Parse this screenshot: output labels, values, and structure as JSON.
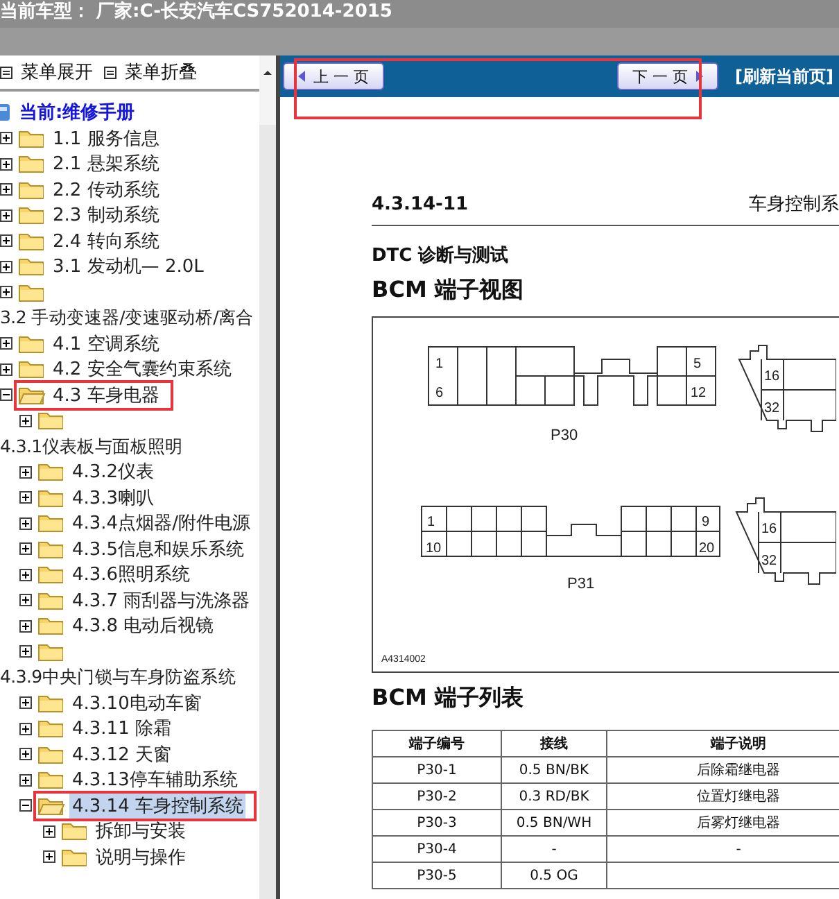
{
  "title_bar": {
    "text": "当前车型：  厂家:C-长安汽车CS752014-2015"
  },
  "tree_toolbar": [
    {
      "label": "菜单展开"
    },
    {
      "label": "菜单折叠"
    }
  ],
  "tree": {
    "root": "当前:维修手册",
    "items": [
      {
        "kind": "folder",
        "label": "1.1 服务信息",
        "expanded": false,
        "selected": false,
        "highlighted": false
      },
      {
        "kind": "folder",
        "label": "2.1 悬架系统",
        "expanded": false,
        "selected": false,
        "highlighted": false
      },
      {
        "kind": "folder",
        "label": "2.2 传动系统",
        "expanded": false,
        "selected": false,
        "highlighted": false
      },
      {
        "kind": "folder",
        "label": "2.3 制动系统",
        "expanded": false,
        "selected": false,
        "highlighted": false
      },
      {
        "kind": "folder",
        "label": "2.4 转向系统",
        "expanded": false,
        "selected": false,
        "highlighted": false
      },
      {
        "kind": "folder",
        "label": "3.1 发动机— 2.0L",
        "expanded": false,
        "selected": false,
        "highlighted": false
      },
      {
        "kind": "wrapped",
        "label": "3.2 手动变速器/变速驱动桥/离合",
        "expanded": false,
        "selected": false,
        "highlighted": false
      },
      {
        "kind": "folder",
        "label": "4.1 空调系统",
        "expanded": false,
        "selected": false,
        "highlighted": false
      },
      {
        "kind": "folder",
        "label": "4.2 安全气囊约束系统",
        "expanded": false,
        "selected": false,
        "highlighted": false
      },
      {
        "kind": "folder",
        "label": "4.3 车身电器",
        "expanded": true,
        "selected": false,
        "highlighted": true,
        "children": [
          {
            "kind": "wrapped",
            "label": "4.3.1仪表板与面板照明",
            "expanded": false,
            "selected": false,
            "highlighted": false
          },
          {
            "kind": "folder",
            "label": "4.3.2仪表",
            "expanded": false,
            "selected": false,
            "highlighted": false
          },
          {
            "kind": "folder",
            "label": "4.3.3喇叭",
            "expanded": false,
            "selected": false,
            "highlighted": false
          },
          {
            "kind": "folder",
            "label": "4.3.4点烟器/附件电源",
            "expanded": false,
            "selected": false,
            "highlighted": false
          },
          {
            "kind": "folder",
            "label": "4.3.5信息和娱乐系统",
            "expanded": false,
            "selected": false,
            "highlighted": false
          },
          {
            "kind": "folder",
            "label": "4.3.6照明系统",
            "expanded": false,
            "selected": false,
            "highlighted": false
          },
          {
            "kind": "folder",
            "label": "4.3.7 雨刮器与洗涤器",
            "expanded": false,
            "selected": false,
            "highlighted": false
          },
          {
            "kind": "folder",
            "label": "4.3.8 电动后视镜",
            "expanded": false,
            "selected": false,
            "highlighted": false
          },
          {
            "kind": "wrapped",
            "label": "4.3.9中央门锁与车身防盗系统",
            "expanded": false,
            "selected": false,
            "highlighted": false
          },
          {
            "kind": "folder",
            "label": "4.3.10电动车窗",
            "expanded": false,
            "selected": false,
            "highlighted": false
          },
          {
            "kind": "folder",
            "label": "4.3.11 除霜",
            "expanded": false,
            "selected": false,
            "highlighted": false
          },
          {
            "kind": "folder",
            "label": "4.3.12 天窗",
            "expanded": false,
            "selected": false,
            "highlighted": false
          },
          {
            "kind": "folder",
            "label": "4.3.13停车辅助系统",
            "expanded": false,
            "selected": false,
            "highlighted": false
          },
          {
            "kind": "folder",
            "label": "4.3.14 车身控制系统",
            "expanded": true,
            "selected": true,
            "highlighted": true,
            "children": [
              {
                "kind": "folder",
                "label": "拆卸与安装",
                "expanded": false,
                "selected": false,
                "highlighted": false
              },
              {
                "kind": "folder",
                "label": "说明与操作",
                "expanded": false,
                "selected": false,
                "highlighted": false
              }
            ]
          }
        ]
      }
    ]
  },
  "nav_bar": {
    "prev": "上 一 页",
    "next": "下 一 页",
    "refresh": "[刷新当前页]",
    "highlighted": true
  },
  "document": {
    "page_number": "4.3.14-11",
    "chapter": "车身控制系",
    "section": "DTC 诊断与测试",
    "heading_view": "BCM 端子视图",
    "connectors": [
      {
        "kind": "p30",
        "name": "P30",
        "pins": [
          "1",
          "5",
          "6",
          "12"
        ]
      },
      {
        "kind": "side",
        "pins": [
          "16",
          "32"
        ]
      },
      {
        "kind": "p31",
        "name": "P31",
        "pins": [
          "1",
          "9",
          "10",
          "20"
        ]
      },
      {
        "kind": "side",
        "pins": [
          "16",
          "32"
        ]
      }
    ],
    "figure_code": "A4314002",
    "heading_list": "BCM 端子列表",
    "table": {
      "columns": [
        "端子编号",
        "接线",
        "端子说明"
      ],
      "rows": [
        [
          "P30-1",
          "0.5 BN/BK",
          "后除霜继电器"
        ],
        [
          "P30-2",
          "0.3 RD/BK",
          "位置灯继电器"
        ],
        [
          "P30-3",
          "0.5 BN/WH",
          "后雾灯继电器"
        ],
        [
          "P30-4",
          "-",
          "-"
        ],
        [
          "P30-5",
          "0.5 OG",
          ""
        ]
      ]
    }
  }
}
